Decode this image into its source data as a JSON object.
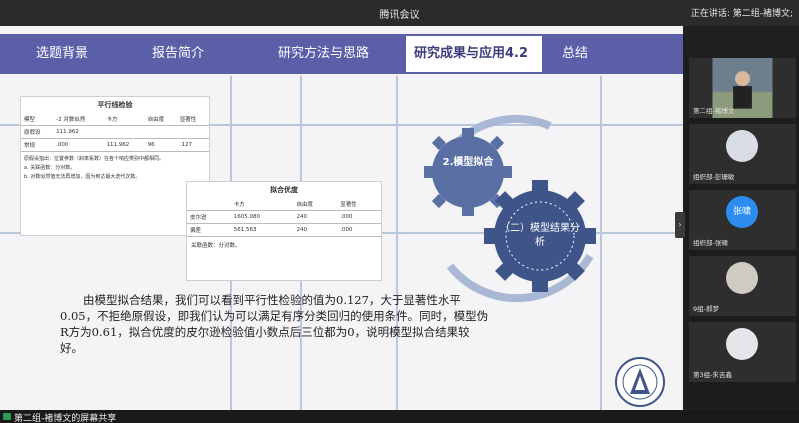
{
  "window": {
    "title": "腾讯会议",
    "speaking": "正在讲话: 第二组-褚博文;"
  },
  "slide": {
    "nav": [
      {
        "label": "选题背景"
      },
      {
        "label": "报告简介"
      },
      {
        "label": "研究方法与思路"
      },
      {
        "label": "研究成果与应用4.2",
        "active": true
      },
      {
        "label": "总结"
      }
    ],
    "doc1": {
      "caption": "平行线检验",
      "headers": [
        "模型",
        "-2 对数似然",
        "卡方",
        "自由度",
        "显著性"
      ],
      "rows": [
        [
          "原假设",
          "111.962",
          "",
          "",
          ""
        ],
        [
          "常规",
          ".000",
          "111.962",
          "96",
          ".127"
        ]
      ],
      "note1": "原假设指出：位置参数（斜率系数）在各个响应类别中都相同。",
      "note2": "a. 关联函数：分对数。",
      "note3": "b. 对数似然值无法再增加，因为到达最大迭代次数。"
    },
    "doc2": {
      "caption": "拟合优度",
      "headers": [
        "",
        "卡方",
        "自由度",
        "显著性"
      ],
      "rows": [
        [
          "皮尔逊",
          "1605.080",
          "240",
          ".000"
        ],
        [
          "偏差",
          "561.563",
          "240",
          ".000"
        ]
      ],
      "note": "关联函数：分对数。"
    },
    "gear_small": "2.模型拟合",
    "gear_big": "（二）模型结果分析",
    "paragraph": "由模型拟合结果，我们可以看到平行性检验的值为0.127，大于显著性水平0.05，不拒绝原假设，即我们认为可以满足有序分类回归的使用条件。同时，模型伪R方为0.61，拟合优度的皮尔逊检验值小数点后三位都为0，说明模型拟合结果较好。"
  },
  "participants": [
    {
      "name": "第二组-褚博文",
      "avatar_color": "#6d7f8f",
      "avatar_text": ""
    },
    {
      "name": "组织部-彭珊敏",
      "avatar_color": "#d9dde6",
      "avatar_text": ""
    },
    {
      "name": "组织部-张啸",
      "avatar_color": "#2d8cf0",
      "avatar_text": "张啸"
    },
    {
      "name": "9组-郝梦",
      "avatar_color": "#cfcac3",
      "avatar_text": ""
    },
    {
      "name": "第3组-朱吉鑫",
      "avatar_color": "#e6e6ea",
      "avatar_text": ""
    }
  ],
  "sharebar": {
    "label": "第二组-褚博文的屏幕共享"
  },
  "colors": {
    "nav": "#5b5fa8",
    "gear": "#5a6fa3",
    "gear_dark": "#3f5488"
  }
}
